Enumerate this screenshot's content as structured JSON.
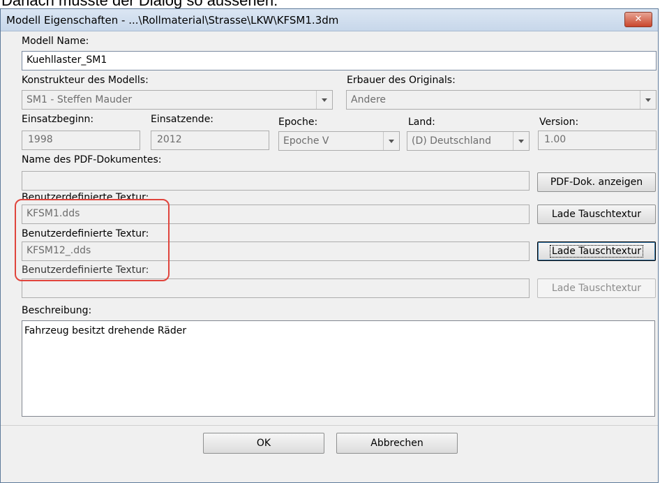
{
  "caption": "Danach müsste der Dialog so aussehen:",
  "window": {
    "title": "Modell Eigenschaften - ...\\Rollmaterial\\Strasse\\LKW\\KFSM1.3dm",
    "close_symbol": "✕"
  },
  "form": {
    "model_name_label": "Modell Name:",
    "model_name_value": "Kuehllaster_SM1",
    "designer_label": "Konstrukteur des Modells:",
    "designer_value": "SM1 - Steffen Mauder",
    "builder_label": "Erbauer des Originals:",
    "builder_value": "Andere",
    "start_label": "Einsatzbeginn:",
    "start_value": "1998",
    "end_label": "Einsatzende:",
    "end_value": "2012",
    "epoch_label": "Epoche:",
    "epoch_value": "Epoche V",
    "country_label": "Land:",
    "country_value": "(D) Deutschland",
    "version_label": "Version:",
    "version_value": "1.00",
    "pdf_label": "Name des PDF-Dokumentes:",
    "pdf_value": "",
    "pdf_button": "PDF-Dok. anzeigen",
    "texture1_label": "Benutzerdefinierte Textur:",
    "texture1_value": "KFSM1.dds",
    "texture1_button": "Lade Tauschtextur",
    "texture2_label": "Benutzerdefinierte Textur:",
    "texture2_value": "KFSM12_.dds",
    "texture2_button": "Lade Tauschtextur",
    "texture3_label": "Benutzerdefinierte Textur:",
    "texture3_value": "",
    "texture3_button": "Lade Tauschtextur",
    "description_label": "Beschreibung:",
    "description_value": "Fahrzeug besitzt drehende Räder"
  },
  "buttons": {
    "ok": "OK",
    "cancel": "Abbrechen"
  },
  "colors": {
    "highlight": "#e0443c",
    "close_button": "#c9462c"
  }
}
